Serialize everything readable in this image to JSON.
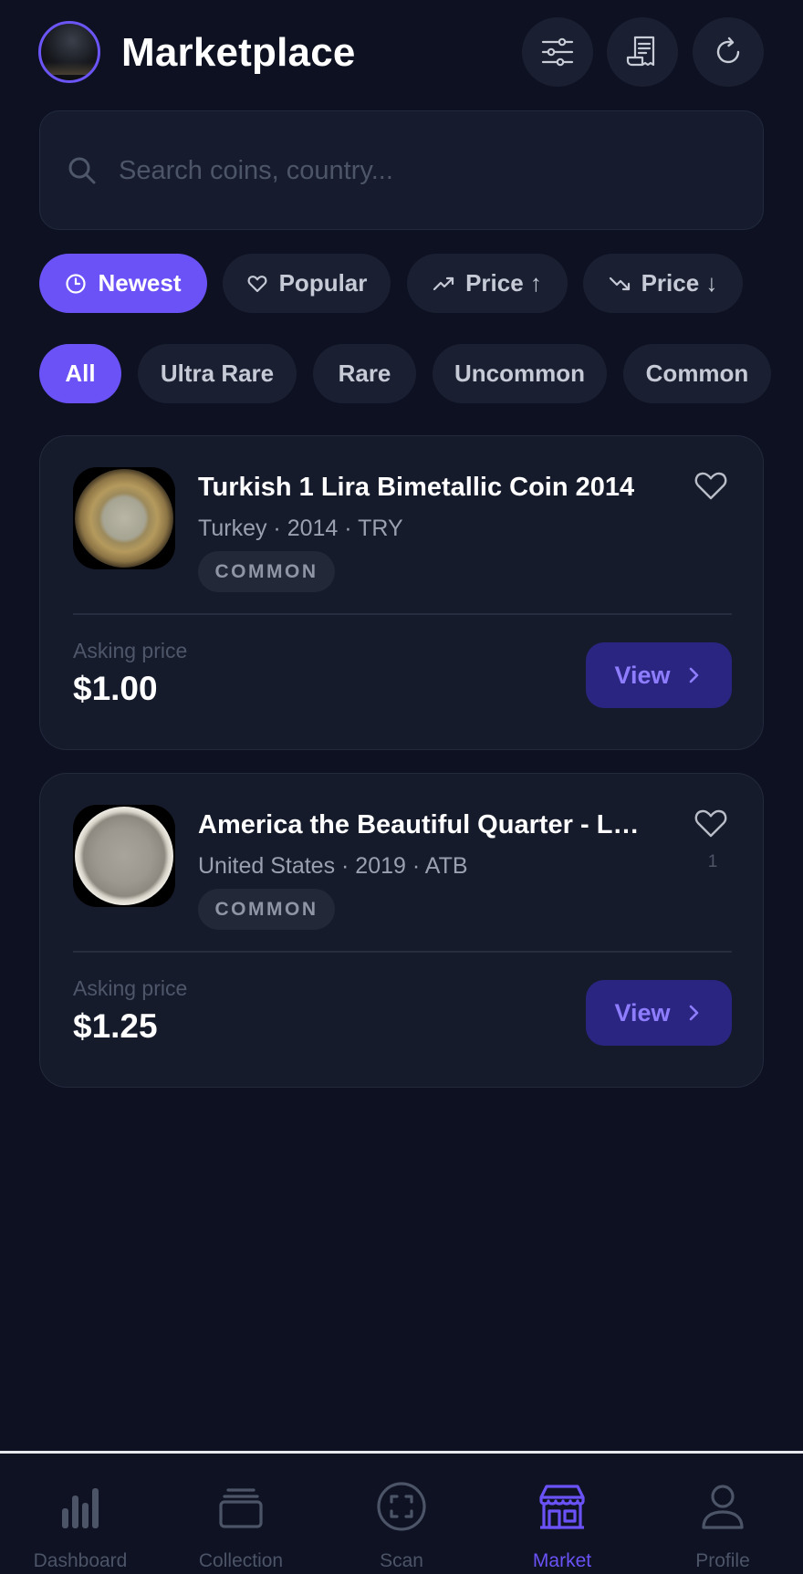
{
  "header": {
    "title": "Marketplace",
    "avatar_icon": "profile-avatar",
    "actions": [
      {
        "name": "filter-settings-icon"
      },
      {
        "name": "receipt-icon"
      },
      {
        "name": "refresh-icon"
      }
    ]
  },
  "search": {
    "placeholder": "Search coins, country...",
    "value": ""
  },
  "sort_chips": [
    {
      "label": "Newest",
      "icon": "clock-icon",
      "active": true
    },
    {
      "label": "Popular",
      "icon": "heart-icon",
      "active": false
    },
    {
      "label": "Price ↑",
      "icon": "trending-up-icon",
      "active": false
    },
    {
      "label": "Price ↓",
      "icon": "trending-down-icon",
      "active": false
    }
  ],
  "rarity_chips": [
    {
      "label": "All",
      "active": true
    },
    {
      "label": "Ultra Rare",
      "active": false
    },
    {
      "label": "Rare",
      "active": false
    },
    {
      "label": "Uncommon",
      "active": false
    },
    {
      "label": "Common",
      "active": false
    }
  ],
  "listings": [
    {
      "title": "Turkish 1 Lira Bimetallic Coin 2014",
      "meta": "Turkey · 2014 · TRY",
      "rarity": "COMMON",
      "favorites": "",
      "price_label": "Asking price",
      "price": "$1.00",
      "view_label": "View"
    },
    {
      "title": "America the Beautiful Quarter - Low...",
      "meta": "United States · 2019 · ATB",
      "rarity": "COMMON",
      "favorites": "1",
      "price_label": "Asking price",
      "price": "$1.25",
      "view_label": "View"
    }
  ],
  "bottom_nav": [
    {
      "label": "Dashboard",
      "icon": "bar-chart-icon",
      "active": false
    },
    {
      "label": "Collection",
      "icon": "stack-icon",
      "active": false
    },
    {
      "label": "Scan",
      "icon": "scan-icon",
      "active": false
    },
    {
      "label": "Market",
      "icon": "storefront-icon",
      "active": true
    },
    {
      "label": "Profile",
      "icon": "person-icon",
      "active": false
    }
  ],
  "colors": {
    "background": "#0d1121",
    "surface": "#161b2c",
    "accent": "#6a52f7",
    "view_button_bg": "#2a2580",
    "view_button_text": "#8f7dff",
    "muted_text": "#9aa0b0"
  }
}
